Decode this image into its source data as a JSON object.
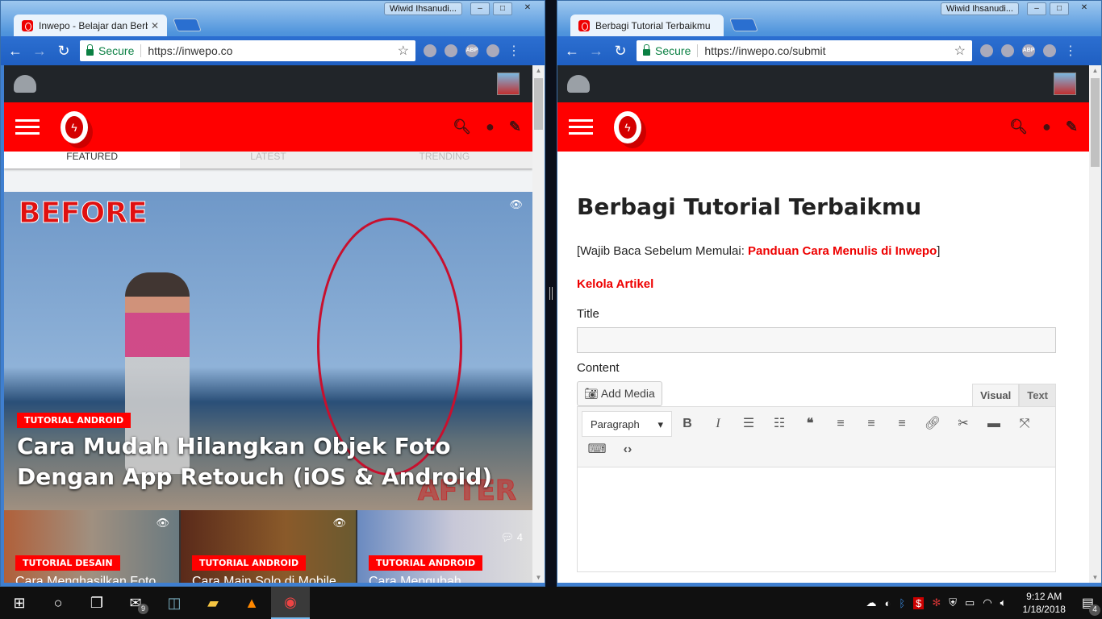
{
  "left": {
    "user": "Wiwid Ihsanudi...",
    "tab_title": "Inwepo - Belajar dan Berb",
    "secure": "Secure",
    "url": "https://inwepo.co",
    "tabs": [
      "FEATURED",
      "LATEST",
      "TRENDING"
    ],
    "hero": {
      "before": "BEFORE",
      "after": "AFTER",
      "category": "TUTORIAL ANDROID",
      "title": "Cara Mudah Hilangkan Objek Foto Dengan App Retouch (iOS & Android)"
    },
    "thumbs": [
      {
        "category": "TUTORIAL DESAIN",
        "title": "Cara Menghasilkan Foto"
      },
      {
        "category": "TUTORIAL ANDROID",
        "title": "Cara Main Solo di Mobile"
      },
      {
        "category": "TUTORIAL ANDROID",
        "title": "Cara Mengubah",
        "comments": "4"
      }
    ]
  },
  "right": {
    "user": "Wiwid Ihsanudi...",
    "tab_title": "Berbagi Tutorial Terbaikmu",
    "secure": "Secure",
    "url": "https://inwepo.co/submit",
    "heading": "Berbagi Tutorial Terbaikmu",
    "notice_prefix": "[Wajib Baca Sebelum Memulai: ",
    "notice_link": "Panduan Cara Menulis di Inwepo",
    "notice_suffix": "]",
    "manage_link": "Kelola Artikel",
    "title_label": "Title",
    "content_label": "Content",
    "add_media": "Add Media",
    "visual": "Visual",
    "text": "Text",
    "format": "Paragraph"
  },
  "taskbar": {
    "mail_count": "9",
    "time": "9:12 AM",
    "date": "1/18/2018",
    "notifications": "4"
  }
}
